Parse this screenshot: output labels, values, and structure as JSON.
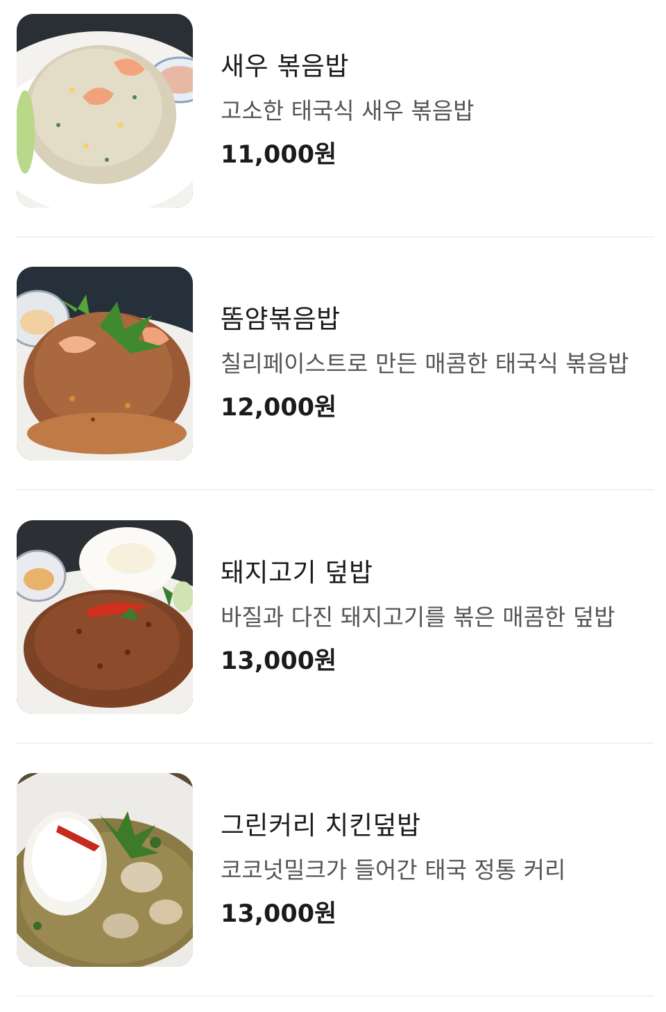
{
  "menu": {
    "items": [
      {
        "name": "새우 볶음밥",
        "description": "고소한 태국식 새우 볶음밥",
        "price": "11,000원",
        "image": "shrimp-fried-rice-photo"
      },
      {
        "name": "똠얌볶음밥",
        "description": "칠리페이스트로 만든 매콤한 태국식 볶음밥",
        "price": "12,000원",
        "image": "tom-yum-fried-rice-photo"
      },
      {
        "name": "돼지고기 덮밥",
        "description": "바질과 다진 돼지고기를 볶은 매콤한 덮밥",
        "price": "13,000원",
        "image": "pork-basil-rice-bowl-photo"
      },
      {
        "name": "그린커리 치킨덮밥",
        "description": "코코넛밀크가 들어간 태국 정통 커리",
        "price": "13,000원",
        "image": "green-curry-chicken-rice-photo"
      }
    ]
  }
}
